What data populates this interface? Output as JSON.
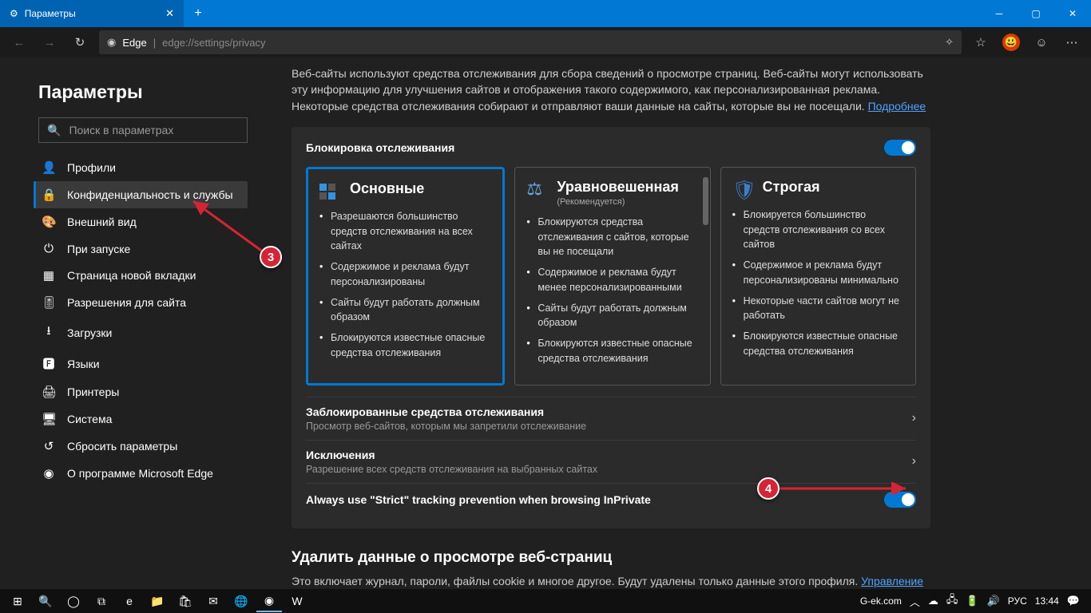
{
  "titlebar": {
    "tab_title": "Параметры",
    "newtab": "+"
  },
  "toolbar": {
    "site_label": "Edge",
    "url": "edge://settings/privacy"
  },
  "sidebar": {
    "title": "Параметры",
    "search_placeholder": "Поиск в параметрах",
    "items": [
      {
        "label": "Профили"
      },
      {
        "label": "Конфиденциальность и службы"
      },
      {
        "label": "Внешний вид"
      },
      {
        "label": "При запуске"
      },
      {
        "label": "Страница новой вкладки"
      },
      {
        "label": "Разрешения для сайта"
      },
      {
        "label": "Загрузки"
      },
      {
        "label": "Языки"
      },
      {
        "label": "Принтеры"
      },
      {
        "label": "Система"
      },
      {
        "label": "Сбросить параметры"
      },
      {
        "label": "О программе Microsoft Edge"
      }
    ]
  },
  "main": {
    "intro": "Веб-сайты используют средства отслеживания для сбора сведений о просмотре страниц. Веб-сайты могут использовать эту информацию для улучшения сайтов и отображения такого содержимого, как персонализированная реклама. Некоторые средства отслеживания собирают и отправляют ваши данные на сайты, которые вы не посещали. ",
    "intro_link": "Подробнее",
    "section_title": "Блокировка отслеживания",
    "cards": {
      "basic": {
        "title": "Основные",
        "bullets": [
          "Разрешаются большинство средств отслеживания на всех сайтах",
          "Содержимое и реклама будут персонализированы",
          "Сайты будут работать должным образом",
          "Блокируются известные опасные средства отслеживания"
        ]
      },
      "balanced": {
        "title": "Уравновешенная",
        "sub": "(Рекомендуется)",
        "bullets": [
          "Блокируются средства отслеживания с сайтов, которые вы не посещали",
          "Содержимое и реклама будут менее персонализированными",
          "Сайты будут работать должным образом",
          "Блокируются известные опасные средства отслеживания"
        ]
      },
      "strict": {
        "title": "Строгая",
        "bullets": [
          "Блокируется большинство средств отслеживания со всех сайтов",
          "Содержимое и реклама будут персонализированы минимально",
          "Некоторые части сайтов могут не работать",
          "Блокируются известные опасные средства отслеживания"
        ]
      }
    },
    "blocked": {
      "title": "Заблокированные средства отслеживания",
      "sub": "Просмотр веб-сайтов, которым мы запретили отслеживание"
    },
    "exceptions": {
      "title": "Исключения",
      "sub": "Разрешение всех средств отслеживания на выбранных сайтах"
    },
    "strict_row": "Always use \"Strict\" tracking prevention when browsing InPrivate",
    "clear_h": "Удалить данные о просмотре веб-страниц",
    "clear_p": "Это включает журнал, пароли, файлы cookie и многое другое. Будут удалены только данные этого профиля. ",
    "clear_link": "Управление"
  },
  "annotations": {
    "a3": "3",
    "a4": "4"
  },
  "tray": {
    "site": "G-ek.com",
    "lang": "РУС",
    "time": "13:44"
  }
}
